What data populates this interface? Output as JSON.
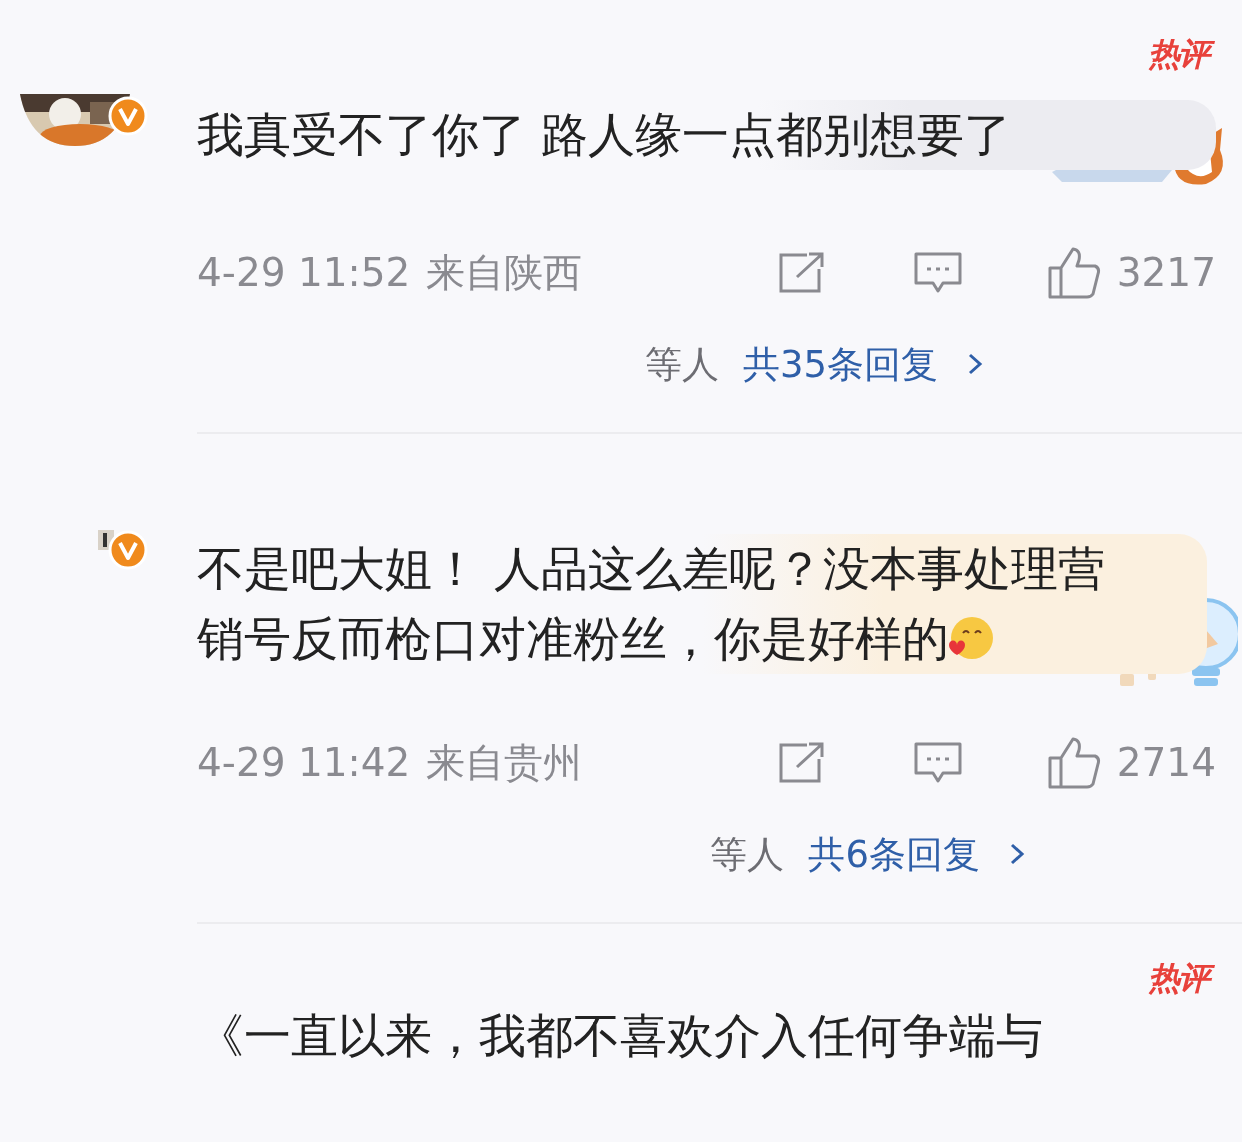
{
  "comments": [
    {
      "hot_badge": "热评",
      "verified": true,
      "text": "我真受不了你了 路人缘一点都别想要了",
      "time": "4-29 11:52",
      "location": "来自陕西",
      "likes": "3217",
      "reply_prefix": "等人",
      "reply_link": "共35条回复"
    },
    {
      "verified": true,
      "text": "不是吧大姐！ 人品这么差呢？没本事处理营销号反而枪口对准粉丝，你是好样的",
      "trailing_emoji": true,
      "time": "4-29 11:42",
      "location": "来自贵州",
      "likes": "2714",
      "reply_prefix": "等人",
      "reply_link": "共6条回复"
    },
    {
      "hot_badge": "热评",
      "text": "《一直以来，我都不喜欢介入任何争端与"
    }
  ]
}
